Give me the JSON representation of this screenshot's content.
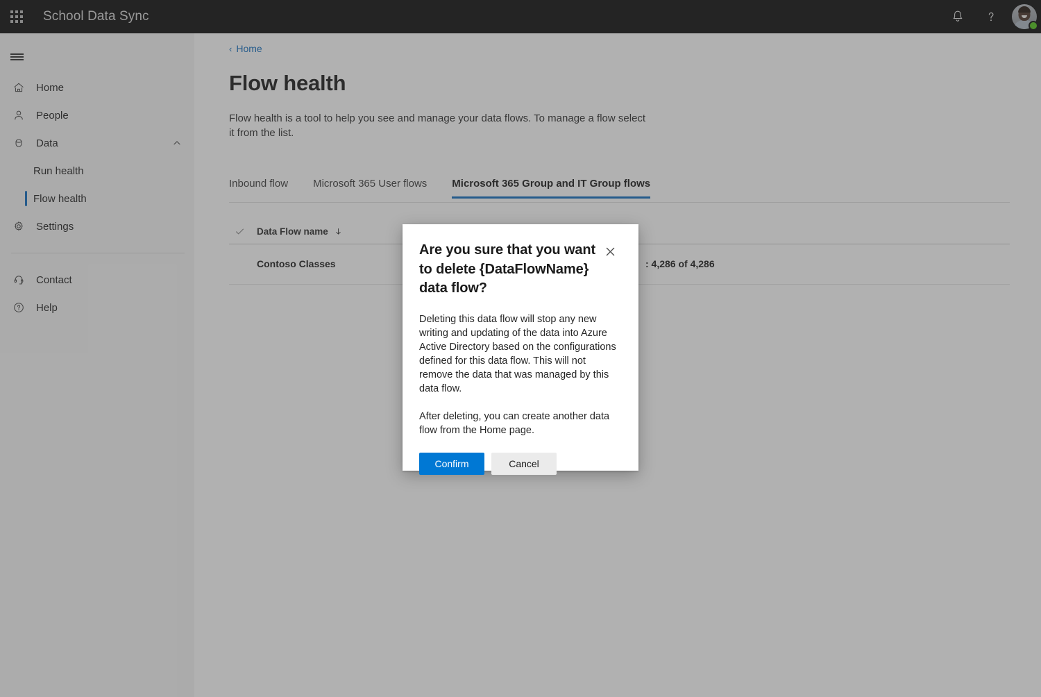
{
  "suite": {
    "waffle_icon": "app-launcher-waffle-icon",
    "title": "School Data Sync",
    "notifications_icon": "bell-icon",
    "help_icon": "question-mark-icon",
    "avatar_icon": "user-avatar",
    "presence": "available"
  },
  "nav": {
    "menu_icon": "hamburger-menu-icon",
    "items": [
      {
        "label": "Home",
        "icon": "home-icon"
      },
      {
        "label": "People",
        "icon": "person-icon"
      },
      {
        "label": "Data",
        "icon": "database-icon",
        "expanded": true,
        "chevron": "chevron-up-icon"
      }
    ],
    "data_children": [
      {
        "label": "Run health",
        "active": false
      },
      {
        "label": "Flow health",
        "active": true
      }
    ],
    "settings": {
      "label": "Settings",
      "icon": "gear-icon"
    },
    "footer_items": [
      {
        "label": "Contact",
        "icon": "headset-icon"
      },
      {
        "label": "Help",
        "icon": "question-circle-icon"
      }
    ]
  },
  "main": {
    "breadcrumb": {
      "chevron": "‹",
      "label": "Home"
    },
    "title": "Flow health",
    "description": "Flow health is a tool to help you see and manage your data flows. To manage a flow select it from the list.",
    "tabs": [
      {
        "label": "Inbound flow",
        "active": false
      },
      {
        "label": "Microsoft 365 User flows",
        "active": false
      },
      {
        "label": "Microsoft 365 Group and IT Group flows",
        "active": true
      }
    ],
    "table": {
      "select_all_icon": "checkmark-icon",
      "columns": [
        {
          "label": "Data Flow name",
          "sort": "descending",
          "sort_icon": "arrow-down-icon"
        }
      ],
      "rows": [
        {
          "name": "Contoso Classes",
          "status": ": 4,286 of 4,286"
        }
      ]
    }
  },
  "dialog": {
    "title": "Are you sure that you want to delete {DataFlowName} data flow?",
    "close_icon": "close-x-icon",
    "paragraphs": [
      "Deleting this data flow will stop any new writing and updating of the data into Azure Active Directory based on the configurations defined for this data flow. This will not remove the data that was managed by this data flow.",
      "After deleting, you can create another data flow from the Home page."
    ],
    "confirm_label": "Confirm",
    "cancel_label": "Cancel"
  },
  "colors": {
    "accent": "#0f6cbd",
    "primary_button": "#0078d4",
    "suite_bar": "#0d0d0d",
    "nav_background": "#f5f5f5",
    "presence_green": "#52c41a"
  }
}
